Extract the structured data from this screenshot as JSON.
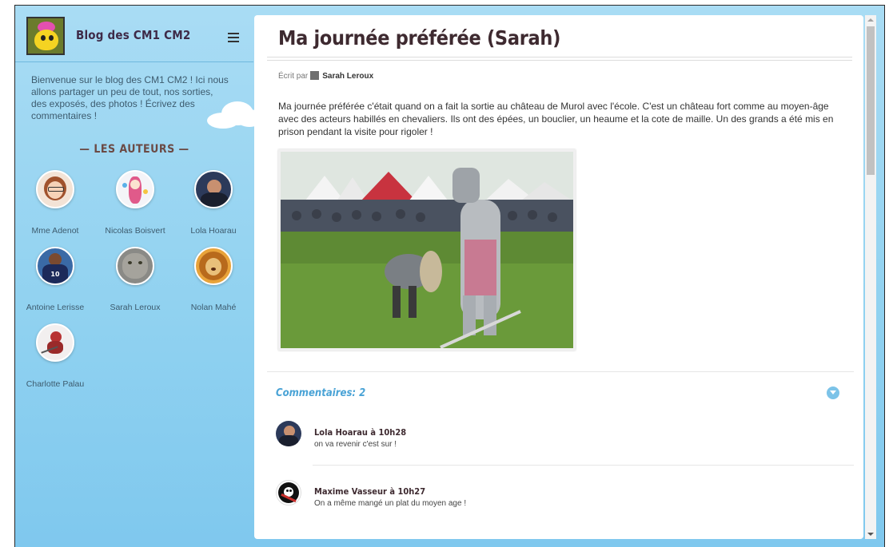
{
  "sidebar": {
    "blog_title": "Blog des CM1 CM2",
    "intro": "Bienvenue sur le blog des CM1 CM2 ! Ici nous allons partager un peu de tout, nos sorties, des exposés, des photos ! Écrivez des commentaires !",
    "authors_title": "— LES AUTEURS —",
    "authors": [
      {
        "name": "Mme Adenot"
      },
      {
        "name": "Nicolas Boisvert"
      },
      {
        "name": "Lola Hoarau"
      },
      {
        "name": "Antoine Lerisse"
      },
      {
        "name": "Sarah Leroux"
      },
      {
        "name": "Nolan Mahé"
      },
      {
        "name": "Charlotte Palau"
      }
    ]
  },
  "post": {
    "title": "Ma journée préférée (Sarah)",
    "byline_prefix": "Écrit par",
    "author": "Sarah Leroux",
    "body": "Ma journée préférée c'était quand on a fait la sortie au château de Murol avec l'école. C'est un château fort comme au moyen-âge avec des acteurs habillés en chevaliers. Ils ont des épées, un bouclier, un heaume et la cote de maille. Un des grands a été mis en prison pendant la visite pour rigoler !"
  },
  "comments": {
    "title": "Commentaires: 2",
    "items": [
      {
        "author": "Lola Hoarau à 10h28",
        "text": "on va revenir c'est sur !"
      },
      {
        "author": "Maxime Vasseur à 10h27",
        "text": "On a même mangé un plat du moyen age !"
      }
    ]
  },
  "colors": {
    "sidebar_bg": "#8fd1f0",
    "title_color": "#3e2a30",
    "accent": "#4aa3d6"
  }
}
